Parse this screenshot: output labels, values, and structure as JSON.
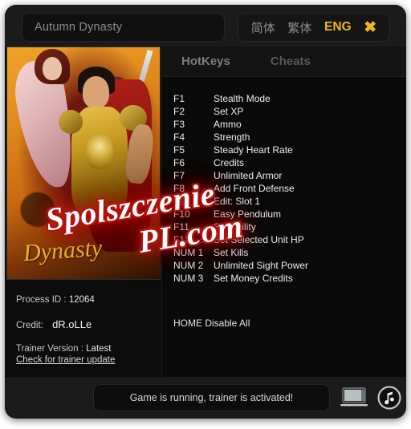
{
  "window": {
    "title_field": {
      "value": "Autumn Dynasty",
      "placeholder": "Autumn Dynasty"
    },
    "languages": [
      {
        "label": "简体",
        "active": false
      },
      {
        "label": "繁体",
        "active": false
      },
      {
        "label": "ENG",
        "active": true
      }
    ],
    "close_label": "✖",
    "accent_color": "#f0b323"
  },
  "cover": {
    "game_title_art": "Dynasty"
  },
  "info": {
    "process_id_label": "Process ID :",
    "process_id_value": "12064",
    "credit_label": "Credit:",
    "credit_value": "dR.oLLe",
    "trainer_version_label": "Trainer Version :",
    "trainer_version_value": "Latest",
    "update_link": "Check for trainer update"
  },
  "tabs": [
    {
      "label": "HotKeys",
      "active": true
    },
    {
      "label": "Cheats",
      "active": false
    }
  ],
  "hotkeys": [
    {
      "key": "F1",
      "label": "Stealth Mode"
    },
    {
      "key": "F2",
      "label": "Set XP"
    },
    {
      "key": "F3",
      "label": "Ammo"
    },
    {
      "key": "F4",
      "label": "Strength"
    },
    {
      "key": "F5",
      "label": "Steady Heart Rate"
    },
    {
      "key": "F6",
      "label": "Credits"
    },
    {
      "key": "F7",
      "label": "Unlimited Armor"
    },
    {
      "key": "F8",
      "label": "Add Front Defense"
    },
    {
      "key": "F9",
      "label": "Edit: Slot 1"
    },
    {
      "key": "F10",
      "label": "Easy Pendulum"
    },
    {
      "key": "F11",
      "label": "Set Agility"
    },
    {
      "key": "F12",
      "label": "Set Selected Unit HP"
    },
    {
      "key": "NUM 1",
      "label": "Set Kills"
    },
    {
      "key": "NUM 2",
      "label": "Unlimited Sight Power"
    },
    {
      "key": "NUM 3",
      "label": "Set Money Credits"
    }
  ],
  "disable_all": "HOME Disable All",
  "statusbar": {
    "message": "Game is running, trainer is activated!",
    "laptop_icon": "laptop-icon",
    "music_icon": "music-note-icon"
  },
  "watermark": {
    "line1": "Spolszczenie",
    "line2": "PL.com"
  }
}
